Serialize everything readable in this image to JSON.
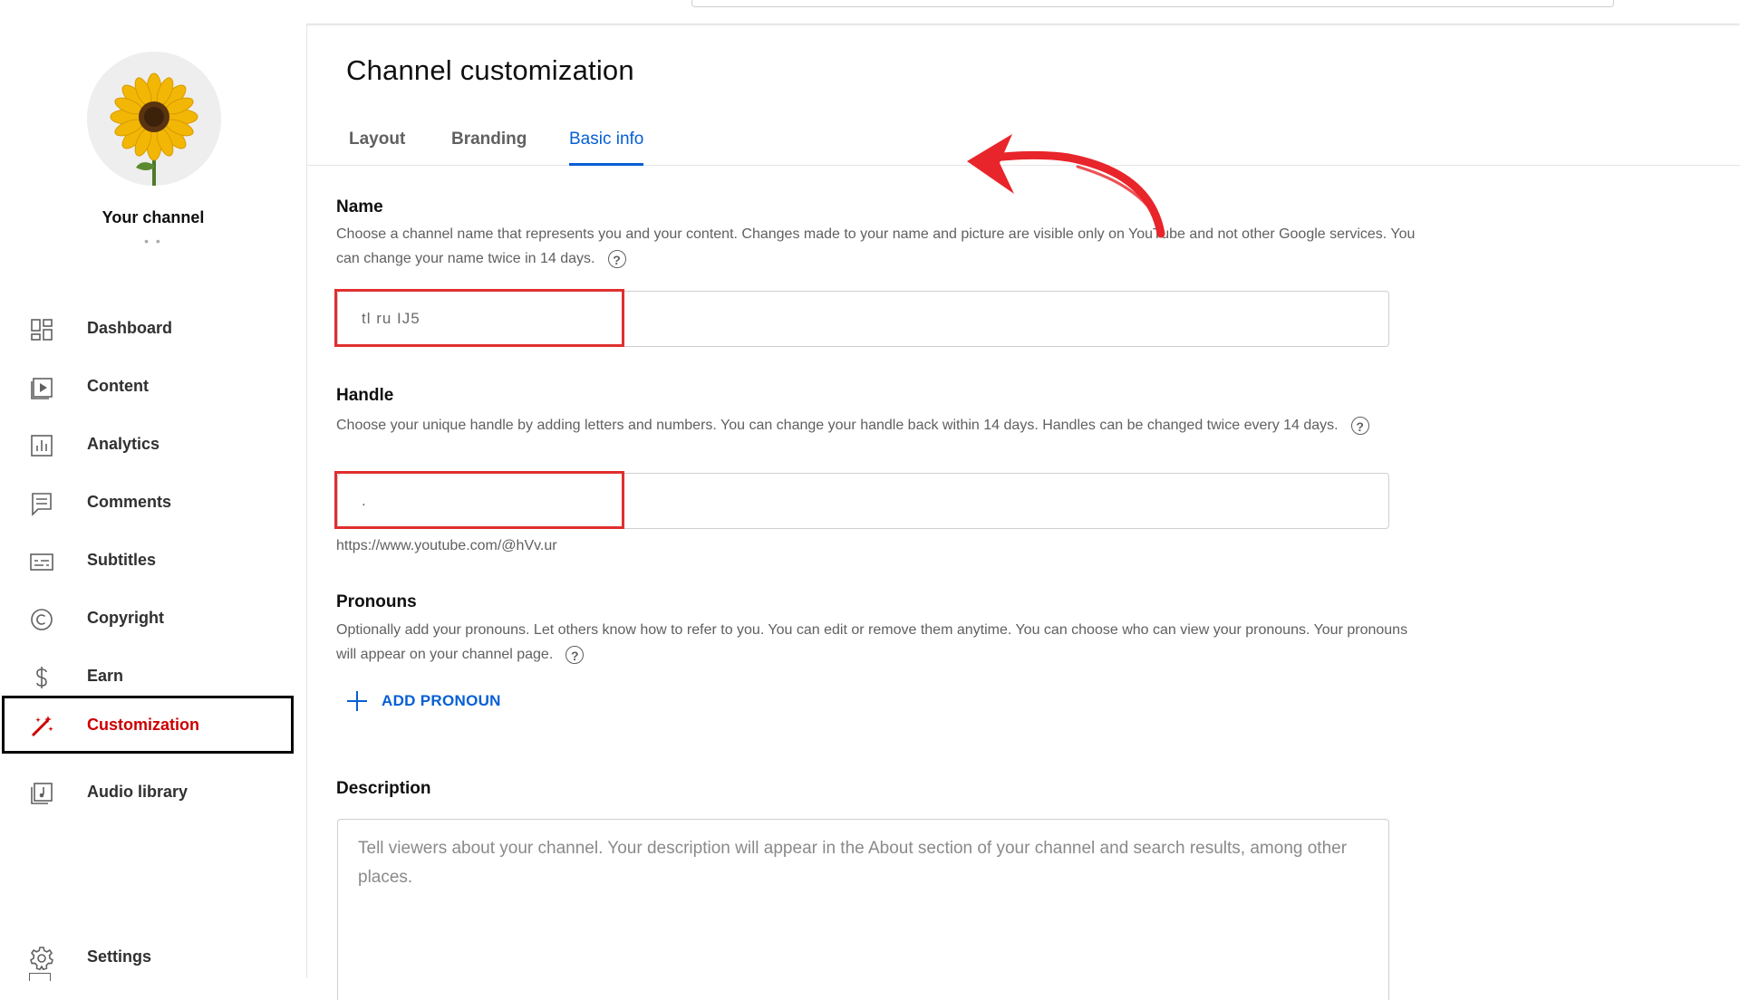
{
  "sidebar": {
    "channel_label": "Your channel",
    "channel_sub": "• •",
    "items": [
      {
        "label": "Dashboard",
        "icon": "dashboard-icon"
      },
      {
        "label": "Content",
        "icon": "content-icon"
      },
      {
        "label": "Analytics",
        "icon": "analytics-icon"
      },
      {
        "label": "Comments",
        "icon": "comments-icon"
      },
      {
        "label": "Subtitles",
        "icon": "subtitles-icon"
      },
      {
        "label": "Copyright",
        "icon": "copyright-icon"
      },
      {
        "label": "Earn",
        "icon": "dollar-icon"
      },
      {
        "label": "Customization",
        "icon": "magic-wand-icon",
        "active": true
      },
      {
        "label": "Audio library",
        "icon": "audio-library-icon"
      }
    ],
    "settings_label": "Settings"
  },
  "main": {
    "title": "Channel customization",
    "tabs": [
      {
        "label": "Layout"
      },
      {
        "label": "Branding"
      },
      {
        "label": "Basic info",
        "active": true
      }
    ],
    "name": {
      "label": "Name",
      "description": "Choose a channel name that represents you and your content. Changes made to your name and picture are visible only on YouTube and not other Google services. You can change your name twice in 14 days.",
      "value": "tl ru IJ5"
    },
    "handle": {
      "label": "Handle",
      "description": "Choose your unique handle by adding letters and numbers. You can change your handle back within 14 days. Handles can be changed twice every 14 days.",
      "value": ".",
      "url": "https://www.youtube.com/@hVv.ur"
    },
    "pronouns": {
      "label": "Pronouns",
      "description": "Optionally add your pronouns. Let others know how to refer to you. You can edit or remove them anytime. You can choose who can view your pronouns. Your pronouns will appear on your channel page.",
      "add_label": "ADD PRONOUN"
    },
    "description": {
      "label": "Description",
      "placeholder": "Tell viewers about your channel. Your description will appear in the About section of your channel and search results, among other places."
    }
  },
  "colors": {
    "accent": "#065fd4",
    "active_nav": "#cc0000",
    "highlight_box": "#e03030",
    "annotation_arrow": "#e8252a"
  },
  "help_glyph": "?"
}
